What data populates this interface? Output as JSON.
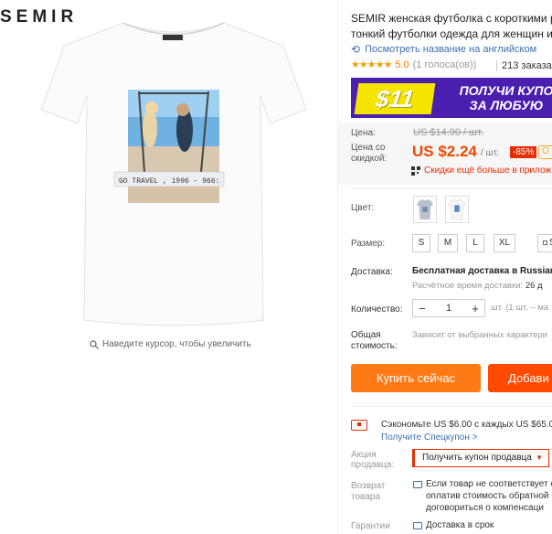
{
  "brand": "SEMIR",
  "zoom_hint": "Наведите курсор, чтобы увеличить",
  "image_caption": "GO TRAVEL , 1996 - 966:",
  "title_line1": "SEMIR женская футболка с короткими р",
  "title_line2": "тонкий футболки одежда для женщин и",
  "translate_link": "Посмотреть название на английском",
  "rating": {
    "stars": "★★★★★",
    "value": "5.0",
    "votes": "(1 голоса(ов))",
    "orders": "213 заказа(о"
  },
  "banner": {
    "price": "$11",
    "line1": "ПОЛУЧИ КУПО",
    "line2": "ЗА ЛЮБУЮ"
  },
  "price": {
    "label_price": "Цена:",
    "old": "US $14.90 / шт.",
    "label_disc1": "Цена со",
    "label_disc2": "скидкой:",
    "current": "US $2.24",
    "unit": "/ шт.",
    "discount": "-85%",
    "tag": "О",
    "app_promo": "Скидки ещё больше в прилож"
  },
  "color": {
    "label": "Цвет:"
  },
  "size": {
    "label": "Размер:",
    "options": [
      "S",
      "M",
      "L",
      "XL",
      "S"
    ]
  },
  "shipping": {
    "label": "Доставка:",
    "value": "Бесплатная доставка в Russian",
    "time_label": "Расчётное время доставки:",
    "time_value": "26 д"
  },
  "quantity": {
    "label": "Количество:",
    "value": "1",
    "minus": "−",
    "plus": "+",
    "note": "шт. (1 шт. – ма"
  },
  "total": {
    "label1": "Общая",
    "label2": "стоимость:",
    "note": "Зависит от выбранных характери"
  },
  "buttons": {
    "buy": "Купить сейчас",
    "cart": "Добави"
  },
  "coupon": {
    "save": "Сэкономьте US $6.00 с каждых US $65.00",
    "link": "Получите Спецкупон >"
  },
  "seller_promo": {
    "label1": "Акция",
    "label2": "продавца:",
    "select": "Получить купон продавца"
  },
  "returns": {
    "label1": "Возврат",
    "label2": "товара",
    "line1": "Если товар не соответствует оп",
    "line2": "оплатив стоимость обратной",
    "line3": "договориться о компенсаци"
  },
  "guarantee": {
    "label1": "Гарантии",
    "line1": "Доставка в срок"
  }
}
